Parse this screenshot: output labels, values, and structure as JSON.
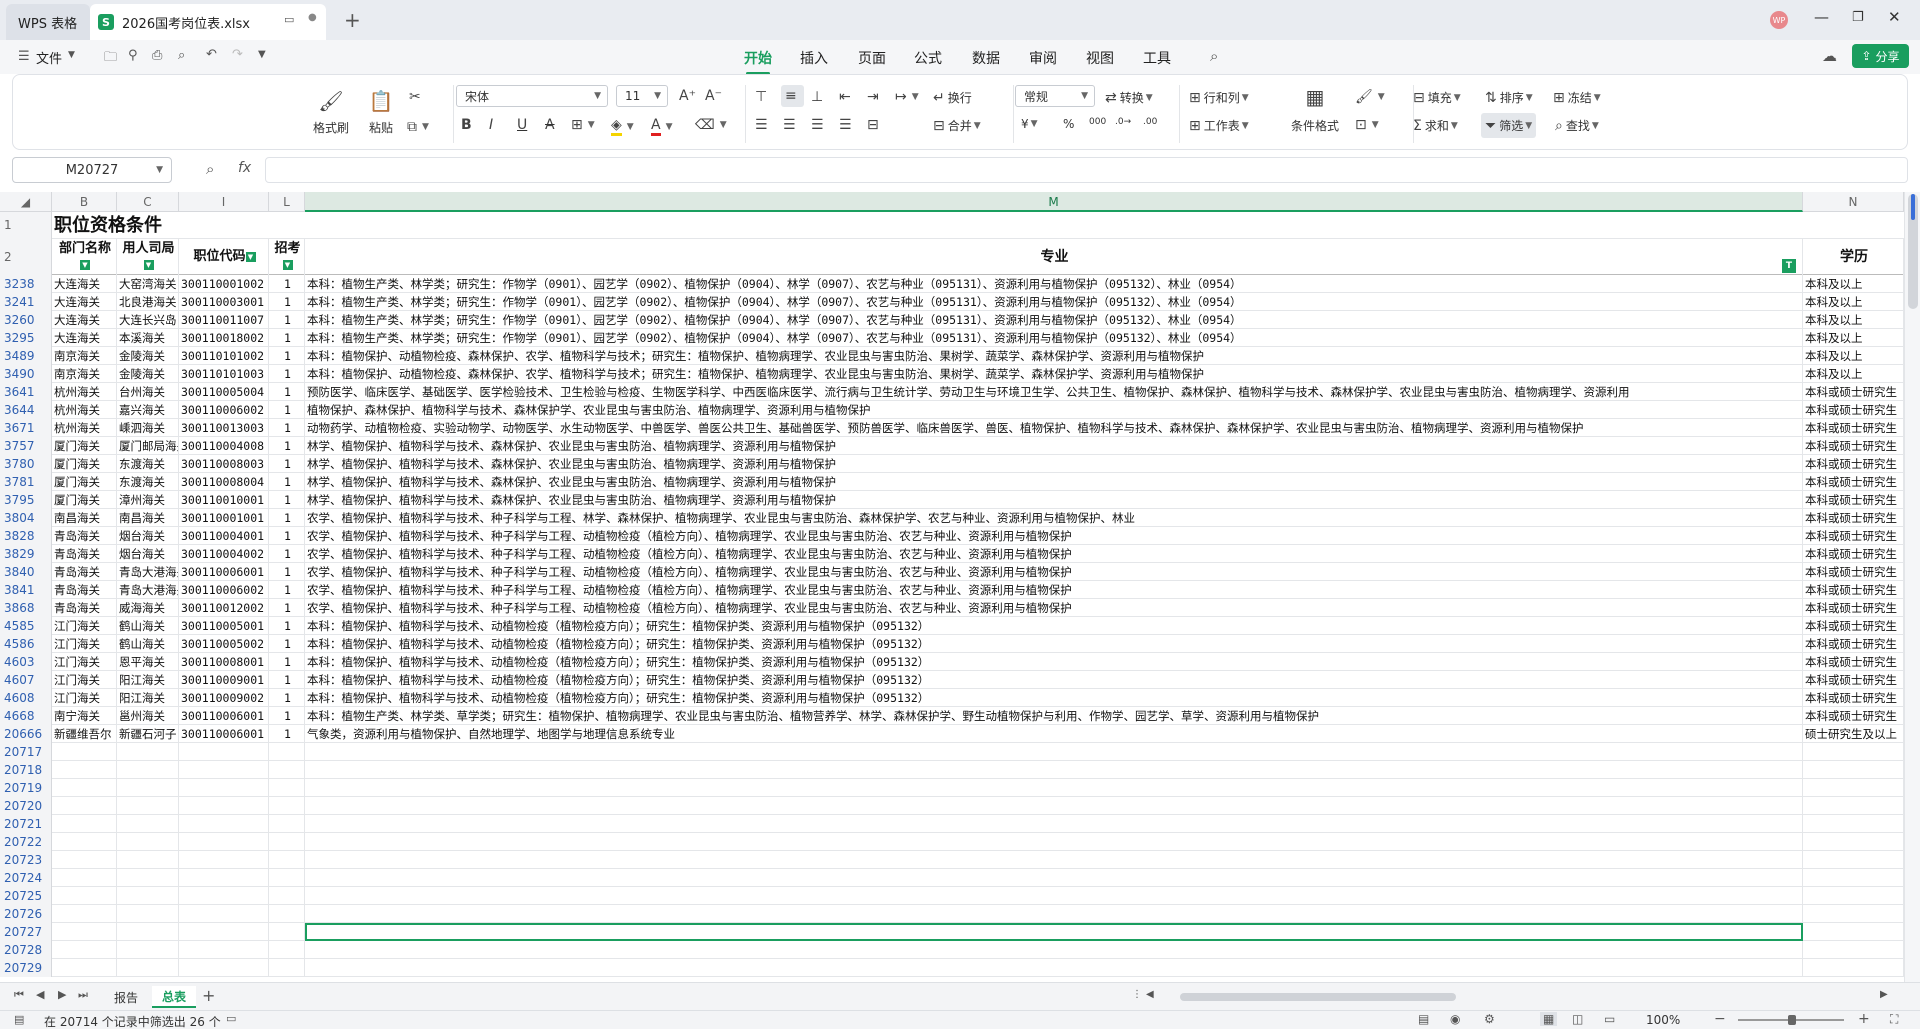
{
  "window": {
    "app_tab": "WPS 表格",
    "file_tab": "2026国考岗位表.xlsx",
    "file_icon": "S",
    "avatar": "WP"
  },
  "menu": {
    "file": "文件",
    "tabs": [
      "开始",
      "插入",
      "页面",
      "公式",
      "数据",
      "审阅",
      "视图",
      "工具"
    ],
    "active": "开始",
    "share": "分享"
  },
  "ribbon": {
    "format_painter": "格式刷",
    "paste": "粘贴",
    "font_name": "宋体",
    "font_size": "11",
    "wrap": "换行",
    "merge": "合并",
    "number_format": "常规",
    "convert": "转换",
    "row_col": "行和列",
    "worksheet": "工作表",
    "cond_format": "条件格式",
    "fill": "填充",
    "sort": "排序",
    "freeze": "冻结",
    "sum": "求和",
    "filter": "筛选",
    "find": "查找",
    "currency": "¥",
    "percent": "%"
  },
  "formula": {
    "name_box": "M20727",
    "fx": "fx",
    "value": ""
  },
  "columns": [
    "B",
    "C",
    "I",
    "L",
    "M",
    "N"
  ],
  "header_row1": {
    "title": "职位资格条件"
  },
  "header_row2": {
    "B": "部门名称",
    "C": "用人司局",
    "I": "职位代码",
    "L": "招考",
    "M": "专业",
    "N": "学历"
  },
  "rows": [
    {
      "n": "3238",
      "B": "大连海关",
      "C": "大窑湾海关",
      "I": "300110001002",
      "L": "1",
      "M": "本科：植物生产类、林学类；研究生：作物学（0901）、园艺学（0902）、植物保护（0904）、林学（0907）、农艺与种业（095131）、资源利用与植物保护（095132）、林业（0954）",
      "N": "本科及以上"
    },
    {
      "n": "3241",
      "B": "大连海关",
      "C": "北良港海关",
      "I": "300110003001",
      "L": "1",
      "M": "本科：植物生产类、林学类；研究生：作物学（0901）、园艺学（0902）、植物保护（0904）、林学（0907）、农艺与种业（095131）、资源利用与植物保护（095132）、林业（0954）",
      "N": "本科及以上"
    },
    {
      "n": "3260",
      "B": "大连海关",
      "C": "大连长兴岛",
      "I": "300110011007",
      "L": "1",
      "M": "本科：植物生产类、林学类；研究生：作物学（0901）、园艺学（0902）、植物保护（0904）、林学（0907）、农艺与种业（095131）、资源利用与植物保护（095132）、林业（0954）",
      "N": "本科及以上"
    },
    {
      "n": "3295",
      "B": "大连海关",
      "C": "本溪海关",
      "I": "300110018002",
      "L": "1",
      "M": "本科：植物生产类、林学类；研究生：作物学（0901）、园艺学（0902）、植物保护（0904）、林学（0907）、农艺与种业（095131）、资源利用与植物保护（095132）、林业（0954）",
      "N": "本科及以上"
    },
    {
      "n": "3489",
      "B": "南京海关",
      "C": "金陵海关",
      "I": "300110101002",
      "L": "1",
      "M": "本科：植物保护、动植物检疫、森林保护、农学、植物科学与技术；研究生：植物保护、植物病理学、农业昆虫与害虫防治、果树学、蔬菜学、森林保护学、资源利用与植物保护",
      "N": "本科及以上"
    },
    {
      "n": "3490",
      "B": "南京海关",
      "C": "金陵海关",
      "I": "300110101003",
      "L": "1",
      "M": "本科：植物保护、动植物检疫、森林保护、农学、植物科学与技术；研究生：植物保护、植物病理学、农业昆虫与害虫防治、果树学、蔬菜学、森林保护学、资源利用与植物保护",
      "N": "本科及以上"
    },
    {
      "n": "3641",
      "B": "杭州海关",
      "C": "台州海关",
      "I": "300110005004",
      "L": "1",
      "M": "预防医学、临床医学、基础医学、医学检验技术、卫生检验与检疫、生物医学科学、中西医临床医学、流行病与卫生统计学、劳动卫生与环境卫生学、公共卫生、植物保护、森林保护、植物科学与技术、森林保护学、农业昆虫与害虫防治、植物病理学、资源利用",
      "N": "本科或硕士研究生"
    },
    {
      "n": "3644",
      "B": "杭州海关",
      "C": "嘉兴海关",
      "I": "300110006002",
      "L": "1",
      "M": "植物保护、森林保护、植物科学与技术、森林保护学、农业昆虫与害虫防治、植物病理学、资源利用与植物保护",
      "N": "本科或硕士研究生"
    },
    {
      "n": "3671",
      "B": "杭州海关",
      "C": "嵊泗海关",
      "I": "300110013003",
      "L": "1",
      "M": "动物药学、动植物检疫、实验动物学、动物医学、水生动物医学、中兽医学、兽医公共卫生、基础兽医学、预防兽医学、临床兽医学、兽医、植物保护、植物科学与技术、森林保护、森林保护学、农业昆虫与害虫防治、植物病理学、资源利用与植物保护",
      "N": "本科或硕士研究生"
    },
    {
      "n": "3757",
      "B": "厦门海关",
      "C": "厦门邮局海关",
      "I": "300110004008",
      "L": "1",
      "M": "林学、植物保护、植物科学与技术、森林保护、农业昆虫与害虫防治、植物病理学、资源利用与植物保护",
      "N": "本科或硕士研究生"
    },
    {
      "n": "3780",
      "B": "厦门海关",
      "C": "东渡海关",
      "I": "300110008003",
      "L": "1",
      "M": "林学、植物保护、植物科学与技术、森林保护、农业昆虫与害虫防治、植物病理学、资源利用与植物保护",
      "N": "本科或硕士研究生"
    },
    {
      "n": "3781",
      "B": "厦门海关",
      "C": "东渡海关",
      "I": "300110008004",
      "L": "1",
      "M": "林学、植物保护、植物科学与技术、森林保护、农业昆虫与害虫防治、植物病理学、资源利用与植物保护",
      "N": "本科或硕士研究生"
    },
    {
      "n": "3795",
      "B": "厦门海关",
      "C": "漳州海关",
      "I": "300110010001",
      "L": "1",
      "M": "林学、植物保护、植物科学与技术、森林保护、农业昆虫与害虫防治、植物病理学、资源利用与植物保护",
      "N": "本科或硕士研究生"
    },
    {
      "n": "3804",
      "B": "南昌海关",
      "C": "南昌海关",
      "I": "300110001001",
      "L": "1",
      "M": "农学、植物保护、植物科学与技术、种子科学与工程、林学、森林保护、植物病理学、农业昆虫与害虫防治、森林保护学、农艺与种业、资源利用与植物保护、林业",
      "N": "本科或硕士研究生"
    },
    {
      "n": "3828",
      "B": "青岛海关",
      "C": "烟台海关",
      "I": "300110004001",
      "L": "1",
      "M": "农学、植物保护、植物科学与技术、种子科学与工程、动植物检疫（植检方向）、植物病理学、农业昆虫与害虫防治、农艺与种业、资源利用与植物保护",
      "N": "本科或硕士研究生"
    },
    {
      "n": "3829",
      "B": "青岛海关",
      "C": "烟台海关",
      "I": "300110004002",
      "L": "1",
      "M": "农学、植物保护、植物科学与技术、种子科学与工程、动植物检疫（植检方向）、植物病理学、农业昆虫与害虫防治、农艺与种业、资源利用与植物保护",
      "N": "本科或硕士研究生"
    },
    {
      "n": "3840",
      "B": "青岛海关",
      "C": "青岛大港海关",
      "I": "300110006001",
      "L": "1",
      "M": "农学、植物保护、植物科学与技术、种子科学与工程、动植物检疫（植检方向）、植物病理学、农业昆虫与害虫防治、农艺与种业、资源利用与植物保护",
      "N": "本科或硕士研究生"
    },
    {
      "n": "3841",
      "B": "青岛海关",
      "C": "青岛大港海关",
      "I": "300110006002",
      "L": "1",
      "M": "农学、植物保护、植物科学与技术、种子科学与工程、动植物检疫（植检方向）、植物病理学、农业昆虫与害虫防治、农艺与种业、资源利用与植物保护",
      "N": "本科或硕士研究生"
    },
    {
      "n": "3868",
      "B": "青岛海关",
      "C": "威海海关",
      "I": "300110012002",
      "L": "1",
      "M": "农学、植物保护、植物科学与技术、种子科学与工程、动植物检疫（植检方向）、植物病理学、农业昆虫与害虫防治、农艺与种业、资源利用与植物保护",
      "N": "本科或硕士研究生"
    },
    {
      "n": "4585",
      "B": "江门海关",
      "C": "鹤山海关",
      "I": "300110005001",
      "L": "1",
      "M": "本科：植物保护、植物科学与技术、动植物检疫（植物检疫方向）；研究生：植物保护类、资源利用与植物保护（095132）",
      "N": "本科或硕士研究生"
    },
    {
      "n": "4586",
      "B": "江门海关",
      "C": "鹤山海关",
      "I": "300110005002",
      "L": "1",
      "M": "本科：植物保护、植物科学与技术、动植物检疫（植物检疫方向）；研究生：植物保护类、资源利用与植物保护（095132）",
      "N": "本科或硕士研究生"
    },
    {
      "n": "4603",
      "B": "江门海关",
      "C": "恩平海关",
      "I": "300110008001",
      "L": "1",
      "M": "本科：植物保护、植物科学与技术、动植物检疫（植物检疫方向）；研究生：植物保护类、资源利用与植物保护（095132）",
      "N": "本科或硕士研究生"
    },
    {
      "n": "4607",
      "B": "江门海关",
      "C": "阳江海关",
      "I": "300110009001",
      "L": "1",
      "M": "本科：植物保护、植物科学与技术、动植物检疫（植物检疫方向）；研究生：植物保护类、资源利用与植物保护（095132）",
      "N": "本科或硕士研究生"
    },
    {
      "n": "4608",
      "B": "江门海关",
      "C": "阳江海关",
      "I": "300110009002",
      "L": "1",
      "M": "本科：植物保护、植物科学与技术、动植物检疫（植物检疫方向）；研究生：植物保护类、资源利用与植物保护（095132）",
      "N": "本科或硕士研究生"
    },
    {
      "n": "4668",
      "B": "南宁海关",
      "C": "邕州海关",
      "I": "300110006001",
      "L": "1",
      "M": "本科：植物生产类、林学类、草学类；研究生：植物保护、植物病理学、农业昆虫与害虫防治、植物营养学、林学、森林保护学、野生动植物保护与利用、作物学、园艺学、草学、资源利用与植物保护",
      "N": "本科或硕士研究生"
    },
    {
      "n": "20666",
      "B": "新疆维吾尔",
      "C": "新疆石河子",
      "I": "300110006001",
      "L": "1",
      "M": "气象类，资源利用与植物保护、自然地理学、地图学与地理信息系统专业",
      "N": "硕士研究生及以上"
    }
  ],
  "empty_rows": [
    "20717",
    "20718",
    "20719",
    "20720",
    "20721",
    "20722",
    "20723",
    "20724",
    "20725",
    "20726",
    "20727",
    "20728",
    "20729"
  ],
  "sheets": {
    "tab1": "报告",
    "tab2": "总表",
    "add": "+"
  },
  "status": {
    "text": "在 20714 个记录中筛选出 26 个",
    "zoom": "100%"
  }
}
